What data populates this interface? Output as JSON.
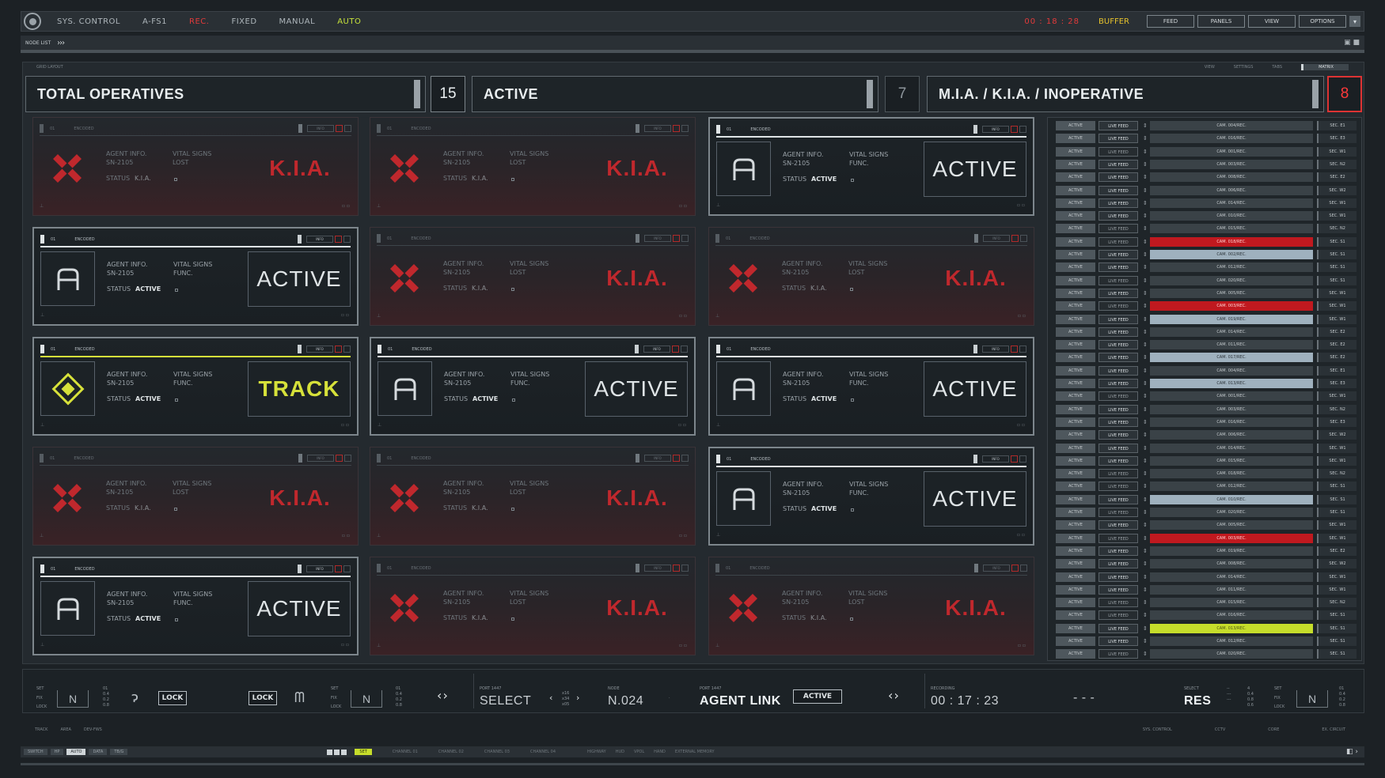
{
  "topbar": {
    "items": [
      "SYS. CONTROL",
      "A-FS1",
      "REC.",
      "FIXED",
      "MANUAL",
      "AUTO"
    ],
    "clock": "00 : 18 : 28",
    "buffer": "BUFFER",
    "buttons": [
      "FEED",
      "PANELS",
      "VIEW",
      "OPTIONS"
    ]
  },
  "nodebar": {
    "label": "NODE LIST",
    "chevrons": "›››"
  },
  "panel_strip": {
    "left": "GRID LAYOUT",
    "right": [
      "VIEW",
      "SETTINGS",
      "TABS"
    ],
    "box": "MATRIX"
  },
  "summary": {
    "total_label": "TOTAL OPERATIVES",
    "total_count": "15",
    "active_label": "ACTIVE",
    "active_count": "7",
    "mia_label": "M.I.A.  /  K.I.A.  /  INOPERATIVE",
    "mia_count": "8"
  },
  "card_text": {
    "header_id": "01",
    "encoded": "ENCODED",
    "info_btn": "INFO",
    "agent_info": "AGENT INFO.",
    "serial": "SN-2105",
    "vital_signs": "VITAL SIGNS",
    "status_label": "STATUS",
    "vital_lost": "LOST",
    "vital_func": "FUNC.",
    "status_kia": "K.I.A.",
    "status_active": "ACTIVE",
    "big_kia": "K.I.A.",
    "big_active": "ACTIVE",
    "big_track": "TRACK"
  },
  "cards": [
    {
      "type": "kia"
    },
    {
      "type": "kia"
    },
    {
      "type": "active"
    },
    {
      "type": "active"
    },
    {
      "type": "kia"
    },
    {
      "type": "kia"
    },
    {
      "type": "track"
    },
    {
      "type": "active"
    },
    {
      "type": "active"
    },
    {
      "type": "kia"
    },
    {
      "type": "kia"
    },
    {
      "type": "active"
    },
    {
      "type": "active"
    },
    {
      "type": "kia"
    },
    {
      "type": "kia"
    }
  ],
  "feed_rows": [
    {
      "status": "ACTIVE",
      "feed": "LIVE FEED",
      "cam": "CAM. 004/REC.",
      "sec": "SEC. E1",
      "hl": "",
      "dim": false
    },
    {
      "status": "ACTIVE",
      "feed": "LIVE FEED",
      "cam": "CAM. 016/REC.",
      "sec": "SEC. E3",
      "hl": "",
      "dim": false
    },
    {
      "status": "ACTIVE",
      "feed": "LIVE FEED",
      "cam": "CAM. 001/REC.",
      "sec": "SEC. W1",
      "hl": "",
      "dim": true
    },
    {
      "status": "ACTIVE",
      "feed": "LIVE FEED",
      "cam": "CAM. 003/REC.",
      "sec": "SEC. N2",
      "hl": "",
      "dim": false
    },
    {
      "status": "ACTIVE",
      "feed": "LIVE FEED",
      "cam": "CAM. 008/REC.",
      "sec": "SEC. E2",
      "hl": "",
      "dim": false
    },
    {
      "status": "ACTIVE",
      "feed": "LIVE FEED",
      "cam": "CAM. 006/REC.",
      "sec": "SEC. W2",
      "hl": "",
      "dim": false
    },
    {
      "status": "ACTIVE",
      "feed": "LIVE FEED",
      "cam": "CAM. 014/REC.",
      "sec": "SEC. W1",
      "hl": "",
      "dim": false
    },
    {
      "status": "ACTIVE",
      "feed": "LIVE FEED",
      "cam": "CAM. 010/REC.",
      "sec": "SEC. W1",
      "hl": "",
      "dim": false
    },
    {
      "status": "ACTIVE",
      "feed": "LIVE FEED",
      "cam": "CAM. 015/REC.",
      "sec": "SEC. N2",
      "hl": "",
      "dim": true
    },
    {
      "status": "ACTIVE",
      "feed": "LIVE FEED",
      "cam": "CAM. 018/REC.",
      "sec": "SEC. S1",
      "hl": "red",
      "dim": true
    },
    {
      "status": "ACTIVE",
      "feed": "LIVE FEED",
      "cam": "CAM. 002/REC.",
      "sec": "SEC. S1",
      "hl": "blue",
      "dim": false
    },
    {
      "status": "ACTIVE",
      "feed": "LIVE FEED",
      "cam": "CAM. 012/REC.",
      "sec": "SEC. S1",
      "hl": "",
      "dim": false
    },
    {
      "status": "ACTIVE",
      "feed": "LIVE FEED",
      "cam": "CAM. 020/REC.",
      "sec": "SEC. S1",
      "hl": "",
      "dim": true
    },
    {
      "status": "ACTIVE",
      "feed": "LIVE FEED",
      "cam": "CAM. 005/REC.",
      "sec": "SEC. W1",
      "hl": "",
      "dim": false
    },
    {
      "status": "ACTIVE",
      "feed": "LIVE FEED",
      "cam": "CAM. 003/REC.",
      "sec": "SEC. W1",
      "hl": "red",
      "dim": true
    },
    {
      "status": "ACTIVE",
      "feed": "LIVE FEED",
      "cam": "CAM. 019/REC.",
      "sec": "SEC. W1",
      "hl": "blue",
      "dim": false
    },
    {
      "status": "ACTIVE",
      "feed": "LIVE FEED",
      "cam": "CAM. 014/REC.",
      "sec": "SEC. E2",
      "hl": "",
      "dim": false
    },
    {
      "status": "ACTIVE",
      "feed": "LIVE FEED",
      "cam": "CAM. 011/REC.",
      "sec": "SEC. E2",
      "hl": "",
      "dim": false
    },
    {
      "status": "ACTIVE",
      "feed": "LIVE FEED",
      "cam": "CAM. 017/REC.",
      "sec": "SEC. E2",
      "hl": "blue",
      "dim": false
    },
    {
      "status": "ACTIVE",
      "feed": "LIVE FEED",
      "cam": "CAM. 004/REC.",
      "sec": "SEC. E1",
      "hl": "",
      "dim": false
    },
    {
      "status": "ACTIVE",
      "feed": "LIVE FEED",
      "cam": "CAM. 013/REC.",
      "sec": "SEC. E3",
      "hl": "blue",
      "dim": false
    },
    {
      "status": "ACTIVE",
      "feed": "LIVE FEED",
      "cam": "CAM. 001/REC.",
      "sec": "SEC. W1",
      "hl": "",
      "dim": true
    },
    {
      "status": "ACTIVE",
      "feed": "LIVE FEED",
      "cam": "CAM. 003/REC.",
      "sec": "SEC. N2",
      "hl": "",
      "dim": false
    },
    {
      "status": "ACTIVE",
      "feed": "LIVE FEED",
      "cam": "CAM. 016/REC.",
      "sec": "SEC. E3",
      "hl": "",
      "dim": false
    },
    {
      "status": "ACTIVE",
      "feed": "LIVE FEED",
      "cam": "CAM. 006/REC.",
      "sec": "SEC. W2",
      "hl": "",
      "dim": false
    },
    {
      "status": "ACTIVE",
      "feed": "LIVE FEED",
      "cam": "CAM. 014/REC.",
      "sec": "SEC. W1",
      "hl": "",
      "dim": false
    },
    {
      "status": "ACTIVE",
      "feed": "LIVE FEED",
      "cam": "CAM. 015/REC.",
      "sec": "SEC. W1",
      "hl": "",
      "dim": false
    },
    {
      "status": "ACTIVE",
      "feed": "LIVE FEED",
      "cam": "CAM. 018/REC.",
      "sec": "SEC. N2",
      "hl": "",
      "dim": true
    },
    {
      "status": "ACTIVE",
      "feed": "LIVE FEED",
      "cam": "CAM. 012/REC.",
      "sec": "SEC. S1",
      "hl": "",
      "dim": true
    },
    {
      "status": "ACTIVE",
      "feed": "LIVE FEED",
      "cam": "CAM. 010/REC.",
      "sec": "SEC. S1",
      "hl": "blue",
      "dim": false
    },
    {
      "status": "ACTIVE",
      "feed": "LIVE FEED",
      "cam": "CAM. 020/REC.",
      "sec": "SEC. S1",
      "hl": "",
      "dim": true
    },
    {
      "status": "ACTIVE",
      "feed": "LIVE FEED",
      "cam": "CAM. 005/REC.",
      "sec": "SEC. W1",
      "hl": "",
      "dim": false
    },
    {
      "status": "ACTIVE",
      "feed": "LIVE FEED",
      "cam": "CAM. 003/REC.",
      "sec": "SEC. W1",
      "hl": "red",
      "dim": true
    },
    {
      "status": "ACTIVE",
      "feed": "LIVE FEED",
      "cam": "CAM. 019/REC.",
      "sec": "SEC. E2",
      "hl": "",
      "dim": false
    },
    {
      "status": "ACTIVE",
      "feed": "LIVE FEED",
      "cam": "CAM. 008/REC.",
      "sec": "SEC. W2",
      "hl": "",
      "dim": false
    },
    {
      "status": "ACTIVE",
      "feed": "LIVE FEED",
      "cam": "CAM. 014/REC.",
      "sec": "SEC. W1",
      "hl": "",
      "dim": false
    },
    {
      "status": "ACTIVE",
      "feed": "LIVE FEED",
      "cam": "CAM. 011/REC.",
      "sec": "SEC. W1",
      "hl": "",
      "dim": false
    },
    {
      "status": "ACTIVE",
      "feed": "LIVE FEED",
      "cam": "CAM. 015/REC.",
      "sec": "SEC. N2",
      "hl": "",
      "dim": true
    },
    {
      "status": "ACTIVE",
      "feed": "LIVE FEED",
      "cam": "CAM. 016/REC.",
      "sec": "SEC. S1",
      "hl": "",
      "dim": true
    },
    {
      "status": "ACTIVE",
      "feed": "LIVE FEED",
      "cam": "CAM. 013/REC.",
      "sec": "SEC. S1",
      "hl": "lime",
      "dim": false
    },
    {
      "status": "ACTIVE",
      "feed": "LIVE FEED",
      "cam": "CAM. 012/REC.",
      "sec": "SEC. S1",
      "hl": "",
      "dim": false
    },
    {
      "status": "ACTIVE",
      "feed": "LIVE FEED",
      "cam": "CAM. 020/REC.",
      "sec": "SEC. S1",
      "hl": "",
      "dim": true
    }
  ],
  "bottom": {
    "set": "SET",
    "fix": "FIX",
    "lock_small": "LOCK",
    "n_glyph": "N",
    "hook_glyph": "ɂ",
    "m_glyph": "ᗰ",
    "lock1": "LOCK",
    "lock2": "LOCK",
    "port1_label": "PORT 1447",
    "select": "SELECT",
    "x_vals": "x16\nx34\nx05",
    "node_label": "NODE",
    "node_value": "N.024",
    "port2_label": "PORT 1447",
    "agent_link": "AGENT LINK",
    "active_btn": "ACTIVE",
    "arrows": "‹ ›",
    "rec_label": "RECORDING",
    "rec_time": "00 : 17 : 23",
    "dashes": "- - -",
    "select_label": "SELECT",
    "res": "RES"
  },
  "strip2": {
    "left": [
      "TRACK",
      "AREA",
      "DEV-FWS"
    ],
    "right": [
      "SYS. CONTROL",
      "CCTV",
      "CORE",
      "EX. CIRCUIT"
    ]
  },
  "status": {
    "buttons": [
      "SWITCH",
      "HP",
      "AUTO",
      "DATA",
      "TB/G"
    ],
    "set": "SET",
    "tags": [
      "CHANNEL 01",
      "CHANNEL 02",
      "CHANNEL 03",
      "CHANNEL 04"
    ],
    "right_tags": [
      "HIGHWAY",
      "HUD",
      "VPOL",
      "HAND",
      "EXTERNAL MEMORY"
    ]
  }
}
